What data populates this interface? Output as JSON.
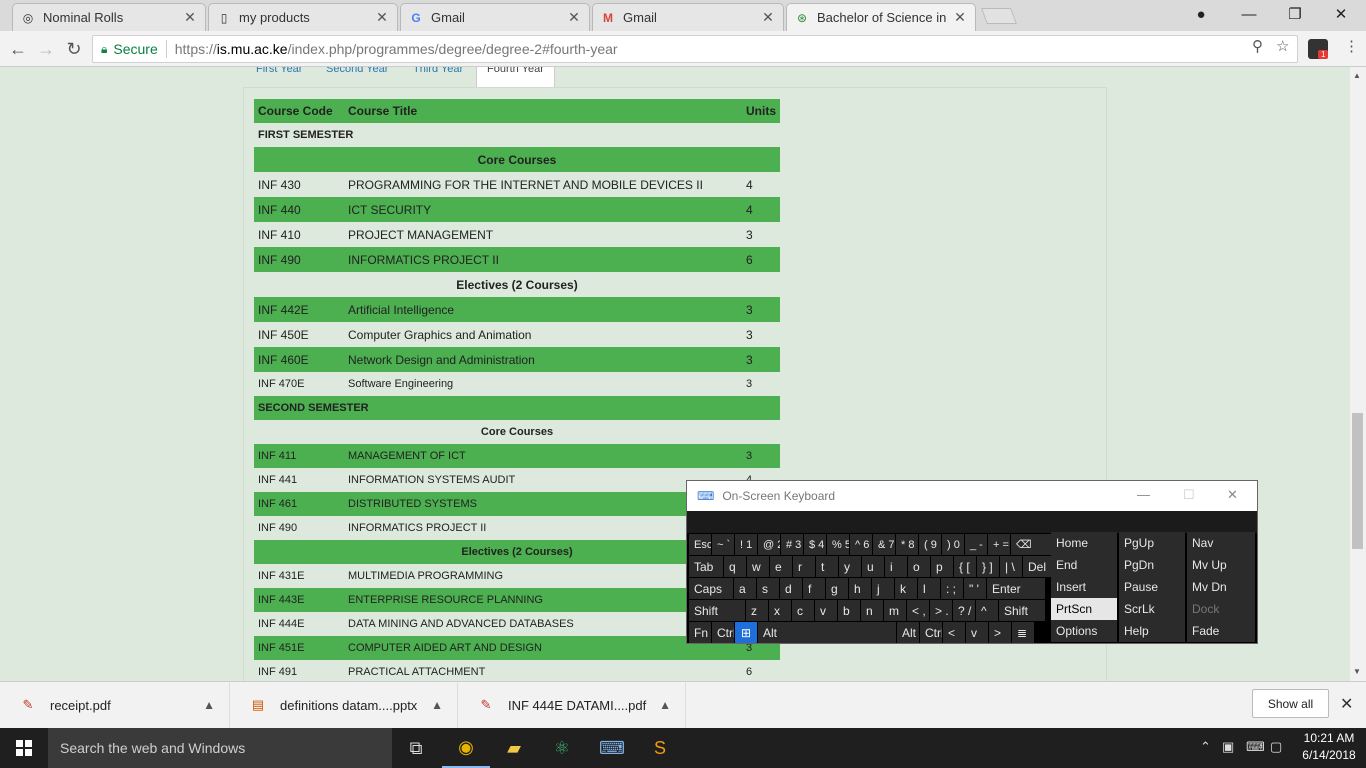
{
  "browser": {
    "tabs": [
      {
        "title": "Nominal Rolls",
        "icon": "globe-icon",
        "active": false
      },
      {
        "title": "my products",
        "icon": "page-icon",
        "active": false
      },
      {
        "title": "Gmail",
        "icon": "google-icon",
        "active": false
      },
      {
        "title": "Gmail",
        "icon": "gmail-icon",
        "active": false
      },
      {
        "title": "Bachelor of Science in Inf",
        "icon": "site-icon",
        "active": true
      }
    ],
    "secure_label": "Secure",
    "url_scheme": "https://",
    "url_host": "is.mu.ac.ke",
    "url_path": "/index.php/programmes/degree/degree-2#fourth-year",
    "extension_badge": "1"
  },
  "year_tabs": [
    "First Year",
    "Second Year",
    "Third Year",
    "Fourth Year"
  ],
  "active_year": "Fourth Year",
  "table": {
    "headers": {
      "code": "Course Code",
      "title": "Course Title",
      "units": "Units"
    },
    "first_semester": "FIRST SEMESTER",
    "core_label_1": "Core Courses",
    "core_1": [
      {
        "code": "INF 430",
        "title": "PROGRAMMING FOR THE INTERNET AND MOBILE DEVICES II",
        "units": "4"
      },
      {
        "code": "INF 440",
        "title": "ICT SECURITY",
        "units": "4"
      },
      {
        "code": "INF 410",
        "title": "PROJECT MANAGEMENT",
        "units": "3"
      },
      {
        "code": "INF 490",
        "title": "INFORMATICS PROJECT II",
        "units": "6"
      }
    ],
    "electives_label_1": "Electives (2 Courses)",
    "electives_1": [
      {
        "code": "INF 442E",
        "title": "Artificial Intelligence",
        "units": "3"
      },
      {
        "code": "INF 450E",
        "title": "Computer Graphics and Animation",
        "units": "3"
      },
      {
        "code": "INF 460E",
        "title": "Network Design and Administration",
        "units": "3"
      },
      {
        "code": "INF 470E",
        "title": "Software Engineering",
        "units": "3"
      }
    ],
    "second_semester": "SECOND SEMESTER",
    "core_label_2": "Core Courses",
    "core_2": [
      {
        "code": "INF 411",
        "title": "MANAGEMENT OF ICT",
        "units": "3"
      },
      {
        "code": "INF 441",
        "title": "INFORMATION SYSTEMS AUDIT",
        "units": "4"
      },
      {
        "code": "INF 461",
        "title": "DISTRIBUTED SYSTEMS",
        "units": ""
      },
      {
        "code": "INF 490",
        "title": "INFORMATICS PROJECT II",
        "units": ""
      }
    ],
    "electives_label_2": "Electives (2 Courses)",
    "electives_2": [
      {
        "code": "INF 431E",
        "title": "MULTIMEDIA PROGRAMMING",
        "units": ""
      },
      {
        "code": "INF 443E",
        "title": "ENTERPRISE RESOURCE PLANNING",
        "units": ""
      },
      {
        "code": "INF 444E",
        "title": "DATA MINING AND ADVANCED DATABASES",
        "units": ""
      },
      {
        "code": "INF 451E",
        "title": "COMPUTER AIDED ART AND DESIGN",
        "units": "3"
      },
      {
        "code": "INF 491",
        "title": "PRACTICAL ATTACHMENT",
        "units": "6"
      }
    ]
  },
  "osk": {
    "title": "On-Screen Keyboard",
    "rows": [
      [
        "Esc",
        "~ `",
        "! 1",
        "@ 2",
        "# 3",
        "$ 4",
        "% 5",
        "^ 6",
        "& 7",
        "* 8",
        "( 9",
        ") 0",
        "_ -",
        "+ =",
        "⌫"
      ],
      [
        "Tab",
        "q",
        "w",
        "e",
        "r",
        "t",
        "y",
        "u",
        "i",
        "o",
        "p",
        "{ [",
        "} ]",
        "| \\",
        "Del"
      ],
      [
        "Caps",
        "a",
        "s",
        "d",
        "f",
        "g",
        "h",
        "j",
        "k",
        "l",
        ": ;",
        "\" '",
        "Enter"
      ],
      [
        "Shift",
        "z",
        "x",
        "c",
        "v",
        "b",
        "n",
        "m",
        "< ,",
        "> .",
        "? /",
        "^",
        "Shift"
      ],
      [
        "Fn",
        "Ctrl",
        "",
        "Alt",
        "Alt",
        "Ctrl",
        "<",
        "v",
        ">",
        "≣"
      ]
    ],
    "nav_keys": [
      [
        "Home",
        "PgUp",
        "Nav"
      ],
      [
        "End",
        "PgDn",
        "Mv Up"
      ],
      [
        "Insert",
        "Pause",
        "Mv Dn"
      ],
      [
        "PrtScn",
        "ScrLk",
        "Dock"
      ],
      [
        "Options",
        "Help",
        "Fade"
      ]
    ]
  },
  "downloads": [
    {
      "name": "receipt.pdf",
      "icon": "pdf-icon"
    },
    {
      "name": "definitions datam....pptx",
      "icon": "pptx-icon"
    },
    {
      "name": "INF 444E DATAMI....pdf",
      "icon": "pdf-icon"
    }
  ],
  "show_all_label": "Show all",
  "taskbar": {
    "search_placeholder": "Search the web and Windows",
    "time": "10:21 AM",
    "date": "6/14/2018"
  }
}
